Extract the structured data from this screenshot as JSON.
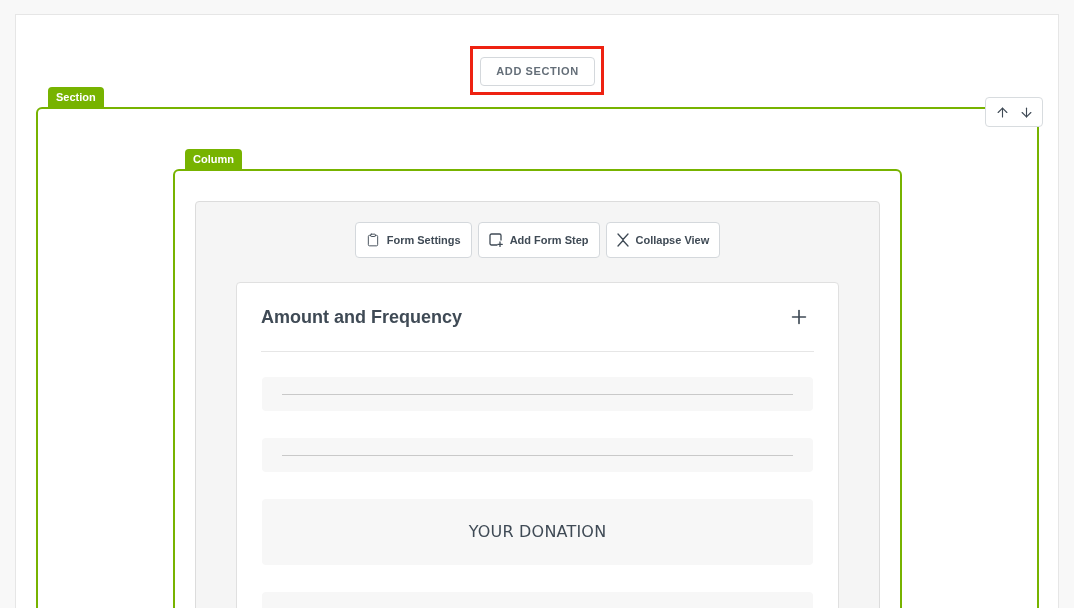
{
  "add_section_button": {
    "label": "ADD SECTION",
    "highlighted": true
  },
  "section": {
    "tag": "Section"
  },
  "column": {
    "tag": "Column"
  },
  "form_toolbar": [
    {
      "label": "Form Settings"
    },
    {
      "label": "Add Form Step"
    },
    {
      "label": "Collapse View"
    }
  ],
  "form_step": {
    "title": "Amount and Frequency",
    "blocks": [
      {
        "kind": "placeholder"
      },
      {
        "kind": "placeholder"
      },
      {
        "kind": "heading",
        "text": "YOUR DONATION"
      },
      {
        "kind": "placeholder"
      }
    ]
  }
}
